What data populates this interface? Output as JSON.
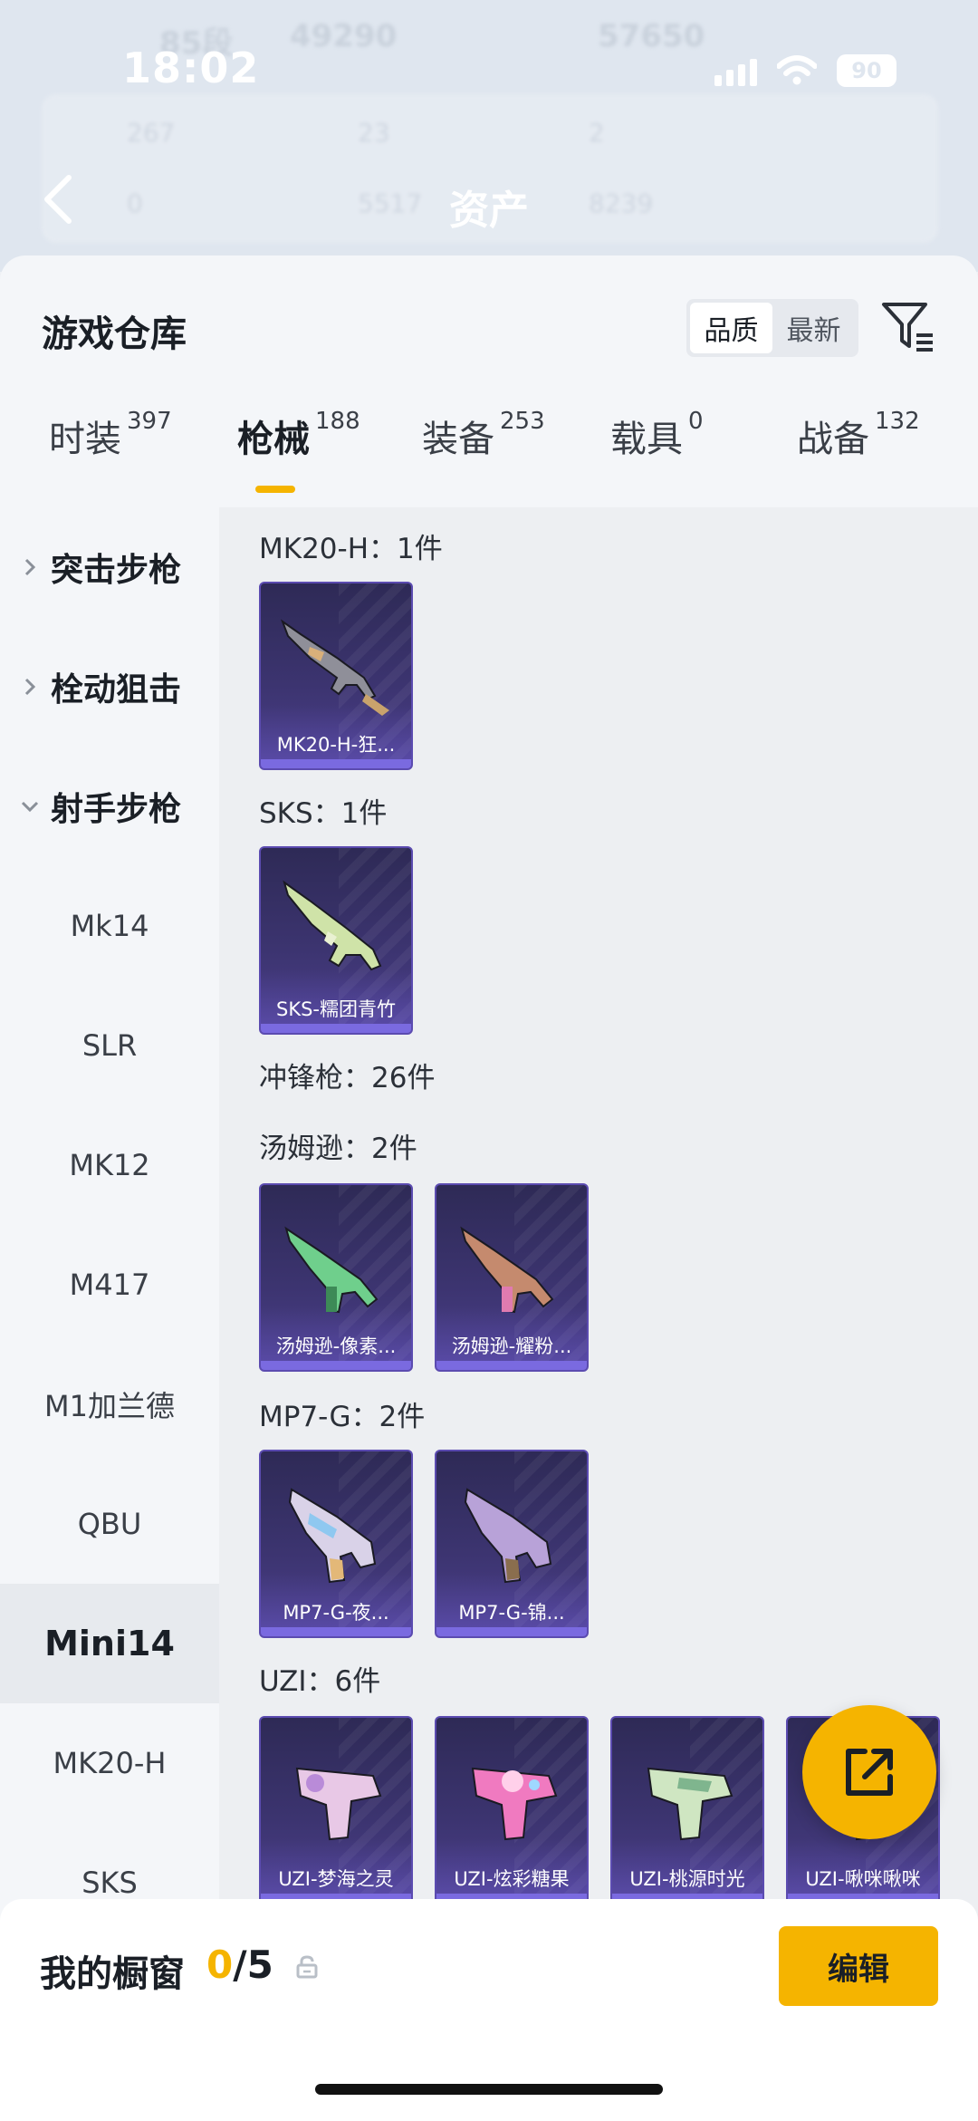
{
  "status_bar": {
    "time": "18:02",
    "battery": "90"
  },
  "header": {
    "title": "资产",
    "ghost": {
      "rank": "85段",
      "coins": "49290",
      "score": "57650",
      "row1": [
        "267",
        "23",
        "2"
      ],
      "row2": [
        "0",
        "5517",
        "8239"
      ]
    }
  },
  "sheet": {
    "title": "游戏仓库",
    "sort": [
      "品质",
      "最新"
    ],
    "tabs": [
      {
        "label": "时装",
        "count": "397"
      },
      {
        "label": "枪械",
        "count": "188"
      },
      {
        "label": "装备",
        "count": "253"
      },
      {
        "label": "载具",
        "count": "0"
      },
      {
        "label": "战备",
        "count": "132"
      }
    ]
  },
  "sidenav": [
    {
      "label": "突击步枪",
      "group": true,
      "expanded": false
    },
    {
      "label": "栓动狙击",
      "group": true,
      "expanded": false
    },
    {
      "label": "射手步枪",
      "group": true,
      "expanded": true
    },
    {
      "label": "Mk14"
    },
    {
      "label": "SLR"
    },
    {
      "label": "MK12"
    },
    {
      "label": "M417"
    },
    {
      "label": "M1加兰德"
    },
    {
      "label": "QBU"
    },
    {
      "label": "Mini14",
      "selected": true
    },
    {
      "label": "MK20-H"
    },
    {
      "label": "SKS"
    }
  ],
  "content": {
    "sections": [
      {
        "label": "MK20-H：1件",
        "items": [
          "MK20-H-狂..."
        ]
      },
      {
        "label": "SKS：1件",
        "items": [
          "SKS-糯团青竹"
        ]
      },
      {
        "label": "冲锋枪：26件",
        "items": []
      },
      {
        "label": "汤姆逊：2件",
        "items": [
          "汤姆逊-像素...",
          "汤姆逊-耀粉..."
        ]
      },
      {
        "label": "MP7-G：2件",
        "items": [
          "MP7-G-夜...",
          "MP7-G-锦..."
        ]
      },
      {
        "label": "UZI：6件",
        "items": [
          "UZI-梦海之灵",
          "UZI-炫彩糖果",
          "UZI-桃源时光",
          "UZI-啾咪啾咪"
        ]
      }
    ]
  },
  "showcase": {
    "title": "我的橱窗",
    "current": "0",
    "total": "/5",
    "edit_label": "编辑"
  },
  "colors": {
    "accent": "#f5b400",
    "card_bg": "#2e2a56",
    "card_border": "#5b4bb0"
  },
  "icons": {
    "back": "chevron-left-icon",
    "filter": "filter-icon",
    "share": "share-external-icon",
    "lock": "lock-icon"
  }
}
